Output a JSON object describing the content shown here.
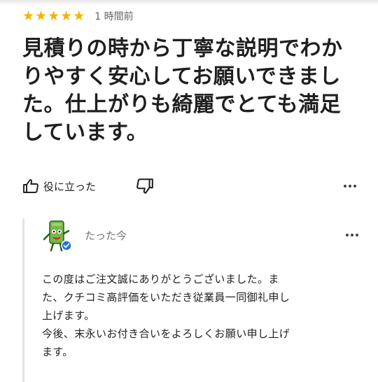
{
  "review": {
    "rating": 5,
    "rating_max": 5,
    "time_ago": "1 時間前",
    "text": "見積りの時から丁寧な説明でわかりやすく安心してお願いできました。仕上がりも綺麗でとても満足しています。"
  },
  "actions": {
    "helpful_label": "役に立った",
    "icons": [
      "thumb-up-icon",
      "thumb-down-icon",
      "more-dots-icon"
    ]
  },
  "reply": {
    "time_ago": "たった今",
    "text_lines": [
      "この度はご注文誠にありがとうございました。ま",
      "た、クチコミ高評価をいただき従業員一同御礼申し",
      "上げます。",
      "今後、末永いお付き合いをよろしくお願い申し上げ",
      "ます。"
    ]
  },
  "colors": {
    "star": "#f5b400",
    "verified_badge": "#1a73e8",
    "avatar_green": "#7ab648"
  }
}
